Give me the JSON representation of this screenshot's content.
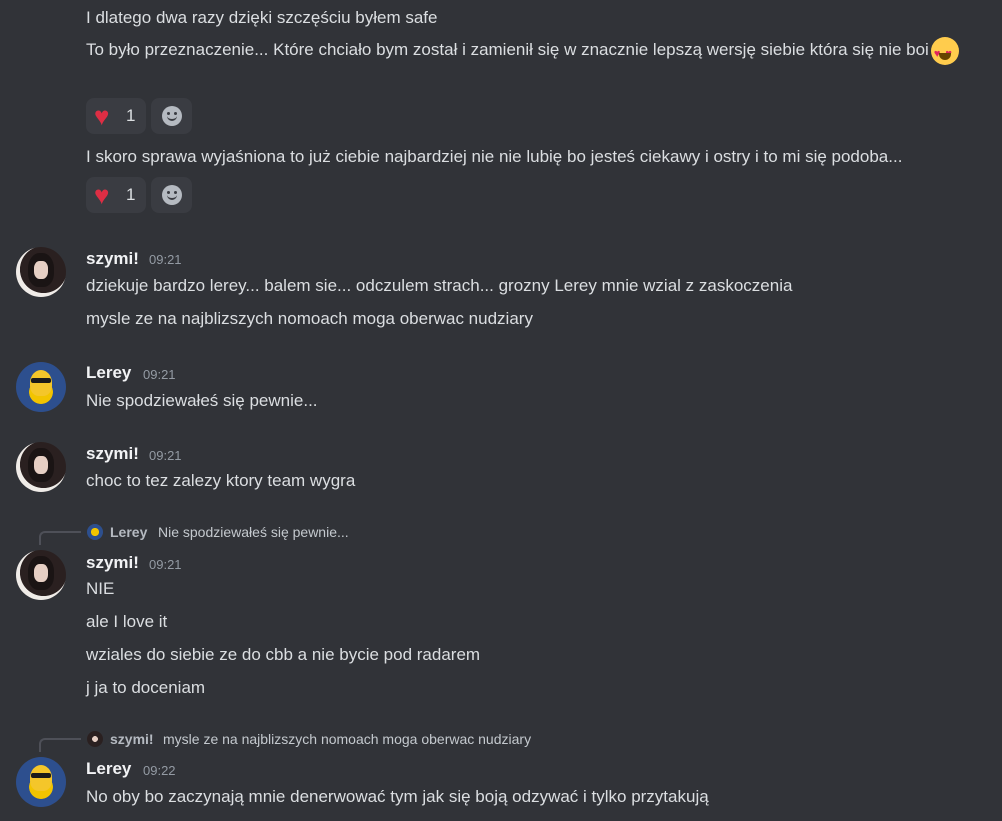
{
  "top_messages": [
    {
      "text": "I dlatego dwa razy dzięki szczęściu byłem safe"
    },
    {
      "text": "To było przeznaczenie... Które chciało bym został i zamienił się w znacznie lepszą wersję siebie która się nie boi"
    }
  ],
  "reactions_1": {
    "emoji": "heart",
    "count": "1"
  },
  "message_3": "I skoro sprawa wyjaśniona to już ciebie najbardziej nie nie lubię bo jesteś ciekawy i ostry i to mi się podoba...",
  "reactions_2": {
    "emoji": "heart",
    "count": "1"
  },
  "groups": [
    {
      "author": "szymi!",
      "time": "09:21",
      "lines": [
        "dziekuje bardzo lerey... balem sie... odczulem strach... grozny Lerey mnie wzial z zaskoczenia",
        "mysle ze na najblizszych nomoach moga oberwac nudziary"
      ]
    },
    {
      "author": "Lerey",
      "time": "09:21",
      "lines": [
        "Nie spodziewałeś się pewnie..."
      ]
    },
    {
      "author": "szymi!",
      "time": "09:21",
      "lines": [
        "choc to tez zalezy ktory team wygra"
      ]
    },
    {
      "reply": {
        "author": "Lerey",
        "text": "Nie spodziewałeś się pewnie..."
      },
      "author": "szymi!",
      "time": "09:21",
      "lines": [
        "NIE",
        "ale I love it",
        "wziales do siebie ze do cbb a nie bycie pod radarem",
        "j ja to doceniam"
      ]
    },
    {
      "reply": {
        "author": "szymi!",
        "text": "mysle ze na najblizszych nomoach moga oberwac nudziary"
      },
      "author": "Lerey",
      "time": "09:22",
      "lines": [
        "No oby bo zaczynają mnie denerwować tym jak się boją odzywać i tylko przytakują"
      ]
    }
  ]
}
